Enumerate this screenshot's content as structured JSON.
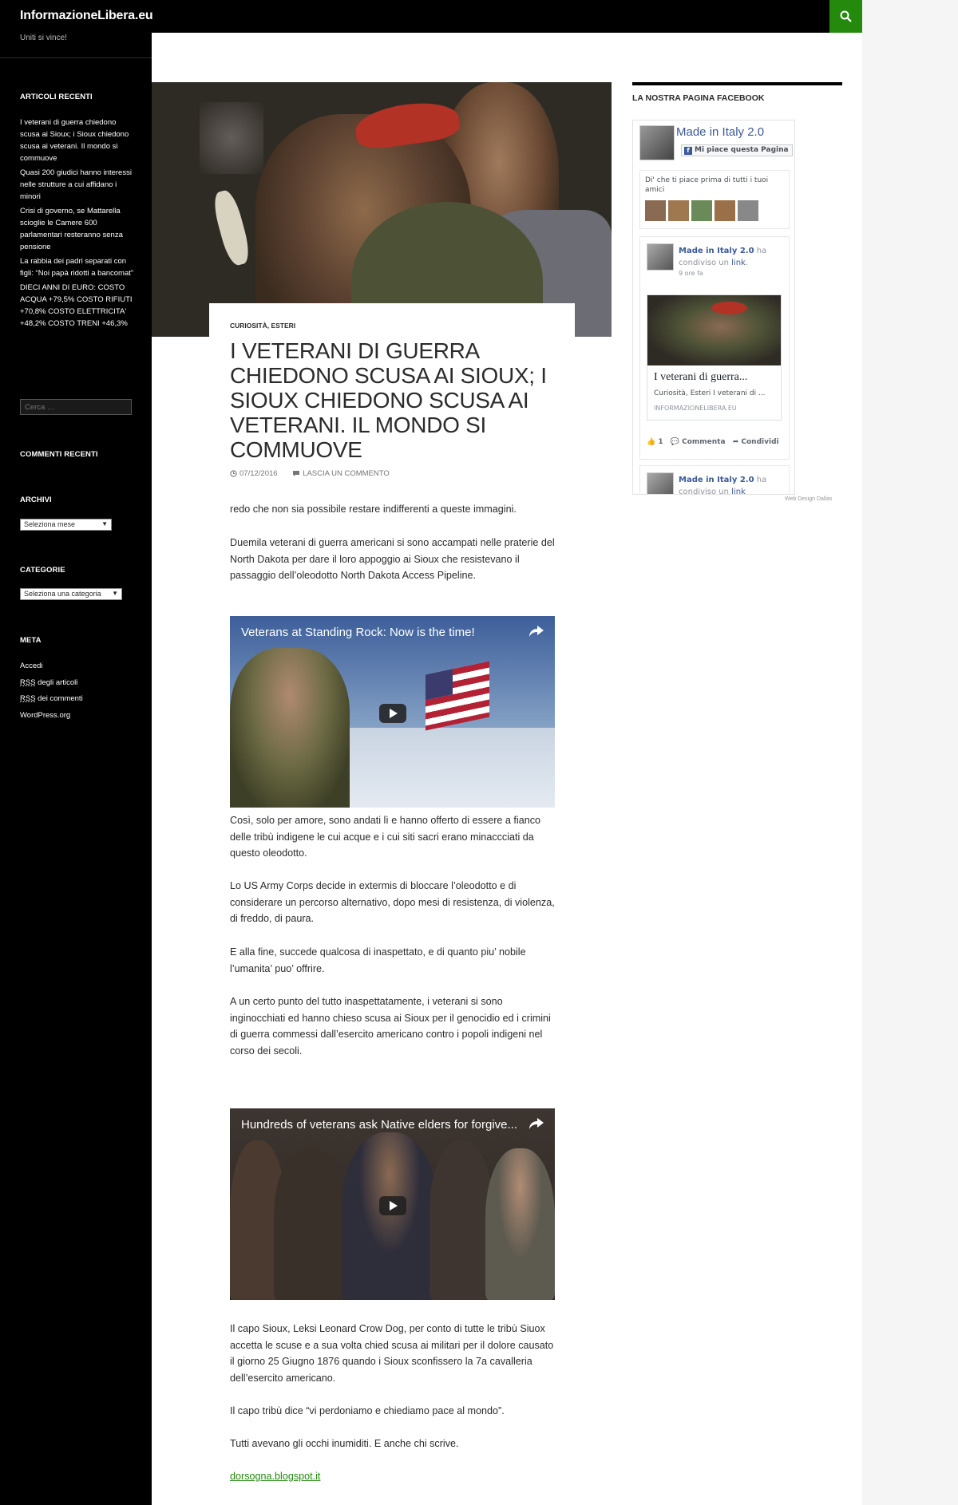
{
  "header": {
    "site_title": "InformazioneLibera.eu",
    "tagline": "Uniti si vince!"
  },
  "sidebar": {
    "recent_title": "ARTICOLI RECENTI",
    "recent_posts": [
      "I veterani di guerra chiedono scusa ai Sioux; i Sioux chiedono scusa ai veterani. Il mondo si commuove",
      "Quasi 200 giudici hanno interessi nelle strutture a cui affidano i minori",
      "Crisi di governo, se Mattarella scioglie le Camere 600 parlamentari resteranno senza pensione",
      "La rabbia dei padri separati con figli: “Noi papà ridotti a bancomat”",
      "DIECI ANNI DI EURO: COSTO ACQUA +79,5% COSTO RIFIUTI +70,8% COSTO ELETTRICITA' +48,2% COSTO TRENI +46,3%"
    ],
    "search_placeholder": "Cerca …",
    "comments_title": "COMMENTI RECENTI",
    "archives_title": "ARCHIVI",
    "archives_select": "Seleziona mese",
    "categories_title": "CATEGORIE",
    "categories_select": "Seleziona una categoria",
    "meta_title": "META",
    "meta_links": {
      "login": "Accedi",
      "rss_abbr": "RSS",
      "rss_articles": " degli articoli",
      "rss_comments": " dei commenti",
      "wordpress": "WordPress.org"
    }
  },
  "article": {
    "categories": "CURIOSITÀ, ESTERI",
    "title": "I VETERANI DI GUERRA CHIEDONO SCUSA AI SIOUX; I SIOUX CHIEDONO SCUSA AI VETERANI. IL MONDO SI COMMUOVE",
    "date": "07/12/2016",
    "comment_link": "LASCIA UN COMMENTO",
    "paragraphs": [
      "redo che non sia possibile restare indifferenti a queste immagini.",
      "Duemila veterani di guerra americani si sono accampati nelle praterie del North Dakota per dare il loro appoggio ai Sioux che resistevano  il passaggio dell’oleodotto North Dakota Access Pipeline.",
      "Così, solo per amore, sono andati lì e hanno offerto di essere a fianco delle tribù indigene le cui acque e i cui siti sacri erano minaccciati da questo oleodotto.",
      "Lo US Army Corps decide in extermis di bloccare l’oleodotto e di considerare un percorso alternativo, dopo mesi di resistenza, di violenza, di freddo, di paura.",
      "E alla fine, succede qualcosa di inaspettato, e di quanto piu’ nobile l’umanita’ puo’ offrire.",
      "A un certo punto del tutto inaspettatamente, i veterani si sono inginocchiati ed hanno chieso scusa ai Sioux per il genocidio ed i crimini di guerra commessi dall’esercito americano contro i popoli indigeni nel corso dei secoli.",
      "Il capo Sioux, Leksi Leonard Crow Dog, per conto di tutte le tribù Siuox accetta le scuse e a sua volta chied scusa ai militari per il dolore causato il giorno 25 Giugno 1876 quando i Sioux sconfissero la 7a cavalleria dell’esercito americano.",
      "Il capo tribù dice “vi perdoniamo e chiediamo pace al mondo”.",
      "Tutti avevano gli occhi inumiditi. E anche chi scrive."
    ],
    "source_link": "dorsogna.blogspot.it",
    "video1_title": "Veterans at Standing Rock: Now is the time!",
    "video2_title": "Hundreds of veterans ask Native elders for forgive..."
  },
  "facebook": {
    "widget_title": "LA NOSTRA PAGINA FACEBOOK",
    "page_name": "Made in Italy 2.0",
    "like_button": "Mi piace questa Pagina",
    "friends_text": "Di' che ti piace prima di tutti i tuoi amici",
    "post_author": "Made in Italy 2.0",
    "post_action_pre": " ha condiviso un ",
    "post_action_link": "link",
    "post_action_post": ".",
    "post_time": "9 ore fa",
    "link_title": "I veterani di guerra...",
    "link_desc": "Curiosità, Esteri I veterani di ...",
    "link_domain": "INFORMAZIONELIBERA.EU",
    "likes_count": "1",
    "comment_label": "Commenta",
    "share_label": "Condividi",
    "post2_author": "Made in Italy 2.0",
    "post2_action_pre": " ha",
    "post2_action_line2": "condiviso un ",
    "post2_action_link": "link",
    "credit": "Web Design Dallas"
  },
  "colors": {
    "accent": "#24890d",
    "header_bg": "#000000",
    "fb_blue": "#3b5998"
  }
}
